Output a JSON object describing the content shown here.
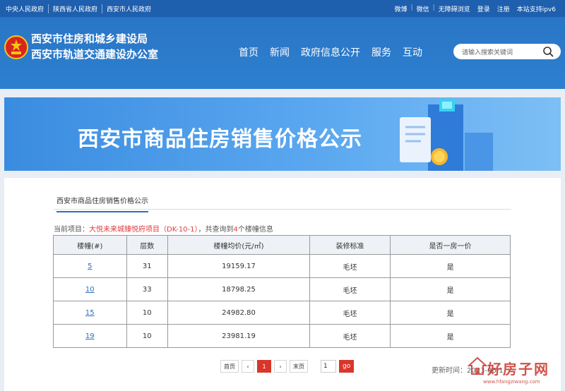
{
  "topbar": {
    "links": [
      "中央人民政府",
      "陕西省人民政府",
      "西安市人民政府"
    ],
    "right": [
      "微博",
      "微信",
      "无障碍浏览",
      "登录",
      "注册",
      "本站支持ipv6"
    ]
  },
  "header": {
    "org_line1": "西安市住房和城乡建设局",
    "org_line2": "西安市轨道交通建设办公室",
    "nav": [
      "首页",
      "新闻",
      "政府信息公开",
      "服务",
      "互动"
    ],
    "search_placeholder": "请输入搜索关键词"
  },
  "banner": {
    "title": "西安市商品住房销售价格公示"
  },
  "content": {
    "tab_label": "西安市商品住房销售价格公示",
    "info_prefix": "当前项目：",
    "project_name": "大悦未来城臻悦府项目（DK-10-1）",
    "info_mid": "，共查询到",
    "count": "4",
    "info_suffix": "个楼幢信息"
  },
  "table": {
    "headers": [
      "楼幢(#)",
      "层数",
      "楼幢均价(元/㎡)",
      "装修标准",
      "是否一房一价"
    ],
    "rows": [
      [
        "5",
        "31",
        "19159.17",
        "毛坯",
        "是"
      ],
      [
        "10",
        "33",
        "18798.25",
        "毛坯",
        "是"
      ],
      [
        "15",
        "10",
        "24982.80",
        "毛坯",
        "是"
      ],
      [
        "19",
        "10",
        "23981.19",
        "毛坯",
        "是"
      ]
    ]
  },
  "pager": {
    "first": "首页",
    "prev": "‹",
    "current": "1",
    "next": "›",
    "last": "末页",
    "page_input": "1",
    "go": "go"
  },
  "updated": "更新时间：2023-06-1",
  "watermark": {
    "text": "好房子网",
    "url": "www.hfangziwang.com"
  },
  "colors": {
    "primary": "#2d7fd0",
    "accent_red": "#d9362b"
  }
}
